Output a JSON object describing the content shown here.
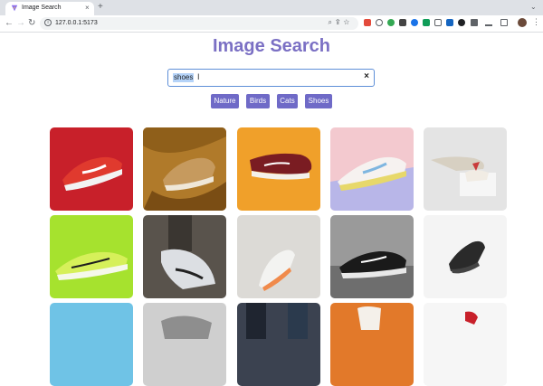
{
  "browser": {
    "tab_title": "Image Search",
    "tab_close": "×",
    "new_tab": "+",
    "url": "127.0.0.1:5173",
    "back": "←",
    "forward": "→",
    "reload": "↻",
    "menu": "⋮",
    "dropdown": "⌄"
  },
  "page": {
    "title": "Image Search",
    "search_value": "shoes",
    "clear_label": "×",
    "chips": [
      "Nature",
      "Birds",
      "Cats",
      "Shoes"
    ]
  },
  "results": [
    {
      "icon": "red-sneaker-image"
    },
    {
      "icon": "tan-sneaker-image"
    },
    {
      "icon": "maroon-sneaker-image"
    },
    {
      "icon": "pastel-sneaker-image"
    },
    {
      "icon": "white-high-top-sneaker-image"
    },
    {
      "icon": "lime-runner-sneaker-image"
    },
    {
      "icon": "white-runner-on-foot-image"
    },
    {
      "icon": "orange-white-runner-image"
    },
    {
      "icon": "black-sneaker-image"
    },
    {
      "icon": "black-sneaker-on-white-image"
    },
    {
      "icon": "blue-background-image"
    },
    {
      "icon": "gray-sneaker-image"
    },
    {
      "icon": "feet-image"
    },
    {
      "icon": "orange-background-image"
    },
    {
      "icon": "red-sneaker-on-white-image"
    }
  ]
}
